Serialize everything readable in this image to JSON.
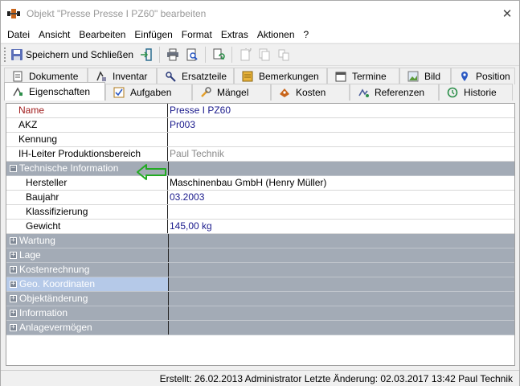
{
  "window": {
    "title": "Objekt \"Presse Presse I PZ60\" bearbeiten",
    "close_icon": "close-icon"
  },
  "menubar": {
    "items": [
      "Datei",
      "Ansicht",
      "Bearbeiten",
      "Einfügen",
      "Format",
      "Extras",
      "Aktionen",
      "?"
    ]
  },
  "toolbar": {
    "save_label": "Speichern und Schließen"
  },
  "tabs": {
    "row1": [
      {
        "label": "Dokumente",
        "icon": "document-icon"
      },
      {
        "label": "Inventar",
        "icon": "inventory-icon"
      },
      {
        "label": "Ersatzteile",
        "icon": "spare-parts-icon"
      },
      {
        "label": "Bemerkungen",
        "icon": "notes-icon"
      },
      {
        "label": "Termine",
        "icon": "calendar-icon"
      },
      {
        "label": "Bild",
        "icon": "image-icon"
      },
      {
        "label": "Position",
        "icon": "location-pin-icon"
      }
    ],
    "row2": [
      {
        "label": "Eigenschaften",
        "icon": "properties-icon",
        "active": true
      },
      {
        "label": "Aufgaben",
        "icon": "tasks-icon"
      },
      {
        "label": "Mängel",
        "icon": "defects-icon"
      },
      {
        "label": "Kosten",
        "icon": "costs-icon"
      },
      {
        "label": "Referenzen",
        "icon": "references-icon"
      },
      {
        "label": "Historie",
        "icon": "history-icon"
      }
    ]
  },
  "properties": {
    "top_rows": [
      {
        "name": "Name",
        "value": "Presse I PZ60"
      },
      {
        "name": "AKZ",
        "value": "Pr003"
      },
      {
        "name": "Kennung",
        "value": ""
      },
      {
        "name": "IH-Leiter Produktionsbereich",
        "value": "Paul Technik"
      }
    ],
    "expanded_category": {
      "label": "Technische Information",
      "expander": "−",
      "rows": [
        {
          "name": "Hersteller",
          "value": "Maschinenbau GmbH  (Henry Müller)"
        },
        {
          "name": "Baujahr",
          "value": "03.2003"
        },
        {
          "name": "Klassifizierung",
          "value": ""
        },
        {
          "name": "Gewicht",
          "value": "145,00 kg"
        }
      ]
    },
    "collapsed_categories": [
      {
        "label": "Wartung",
        "expander": "+"
      },
      {
        "label": "Lage",
        "expander": "+"
      },
      {
        "label": "Kostenrechnung",
        "expander": "+"
      },
      {
        "label": "Geo. Koordinaten",
        "expander": "+",
        "selected": true
      },
      {
        "label": "Objektänderung",
        "expander": "+"
      },
      {
        "label": "Information",
        "expander": "+"
      },
      {
        "label": "Anlagevermögen",
        "expander": "+"
      }
    ]
  },
  "statusbar": {
    "text": "Erstellt: 26.02.2013 Administrator  Letzte Änderung: 02.03.2017 13:42 Paul Technik"
  },
  "colors": {
    "category_bg": "#a3abb6",
    "selected_category_bg": "#b5c9e8",
    "value_blue": "#1a1a8c",
    "name_red": "#a01b1b",
    "annotation_arrow": "#22aa22"
  }
}
